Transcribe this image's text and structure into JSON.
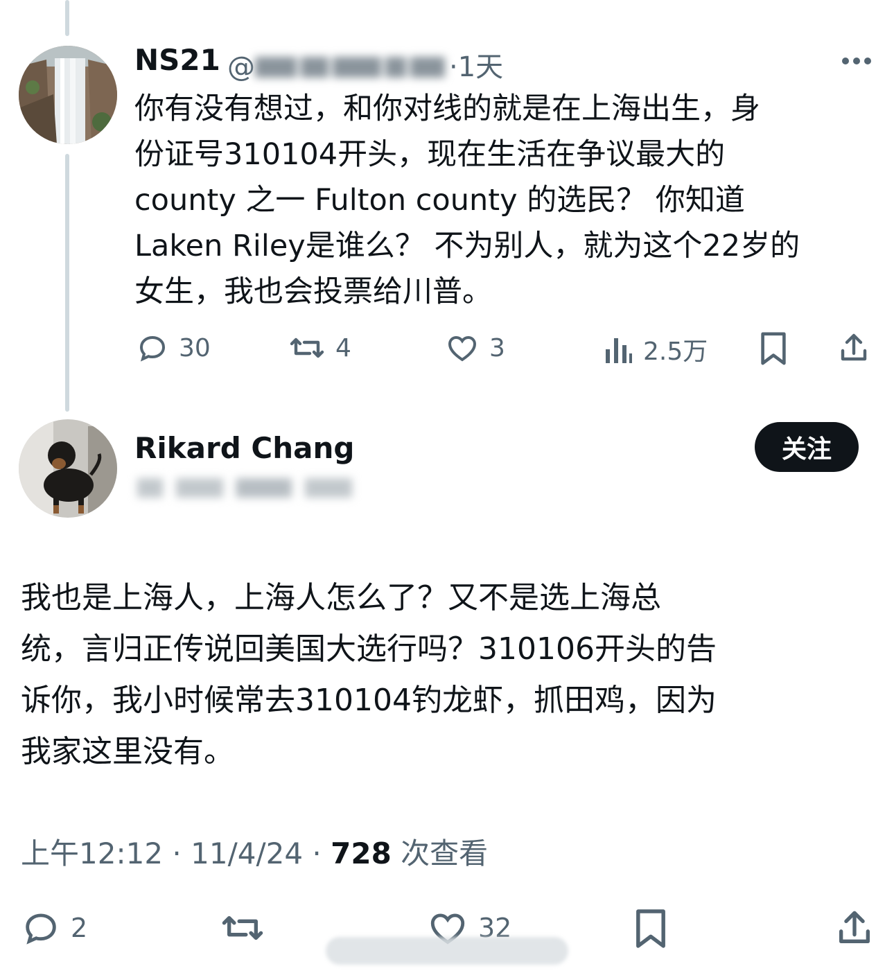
{
  "tweet1": {
    "display_name": "NS21",
    "handle_prefix": "@",
    "time_sep": "·",
    "time": "1天",
    "lines": [
      "你有没有想过，和你对线的就是在上海出生，身",
      "份证号310104开头，现在生活在争议最大的",
      "county 之一 Fulton county 的选民？ 你知道",
      "Laken Riley是谁么？ 不为别人，就为这个22岁的",
      "女生，我也会投票给川普。"
    ],
    "replies": "30",
    "retweets": "4",
    "likes": "3",
    "views": "2.5万"
  },
  "tweet2": {
    "display_name": "Rikard Chang",
    "follow_label": "关注",
    "lines": [
      "我也是上海人，上海人怎么了？又不是选上海总",
      "统，言归正传说回美国大选行吗？310106开头的告",
      "诉你，我小时候常去310104钓龙虾，抓田鸡，因为",
      "我家这里没有。"
    ],
    "time": "上午12:12",
    "sep": "·",
    "date": "11/4/24",
    "views_count": "728",
    "views_label": "次查看",
    "replies": "2",
    "likes": "32"
  },
  "icons": {
    "more": "more-horizontal-icon",
    "reply": "reply-bubble-icon",
    "retweet": "retweet-icon",
    "like": "heart-icon",
    "views": "analytics-bars-icon",
    "bookmark": "bookmark-icon",
    "share": "share-upload-icon"
  },
  "colors": {
    "text": "#0f1419",
    "secondary": "#536471",
    "thread_line": "#cfd9de",
    "follow_button_bg": "#0f1419"
  }
}
